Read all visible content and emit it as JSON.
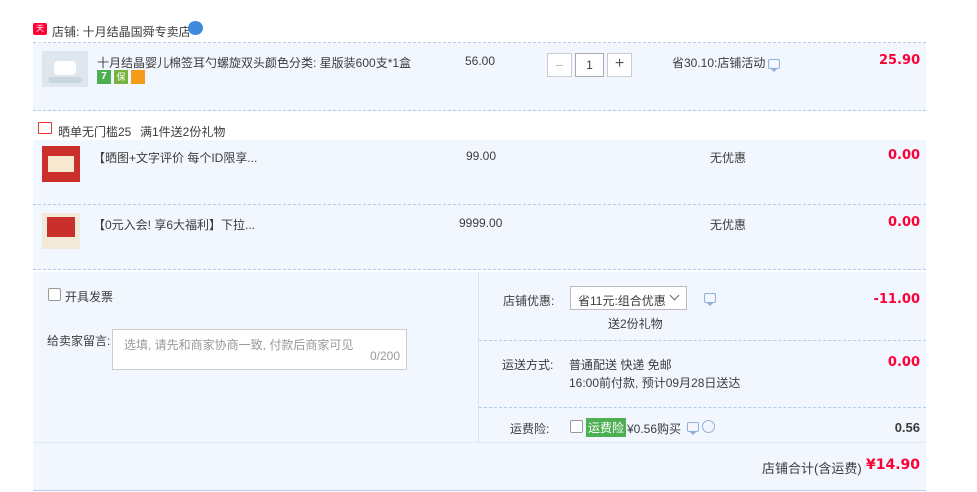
{
  "shop": {
    "badge": "天猫",
    "name": "店铺: 十月结晶国舜专卖店"
  },
  "item": {
    "title": "十月结晶婴儿棉签耳勺螺旋双头...",
    "sku": "颜色分类: 星版装600支*1盒",
    "price": "56.00",
    "minus": "−",
    "qty": "1",
    "plus": "+",
    "discount": "省30.10:店铺活动",
    "subtotal": "25.90",
    "badges": [
      "7",
      "保",
      "卡"
    ]
  },
  "gift_header": {
    "line1": "晒单无门槛25",
    "line2": "满1件送2份礼物"
  },
  "gifts": [
    {
      "title": "【晒图+文字评价 每个ID限享...",
      "price": "99.00",
      "promo": "无优惠",
      "subtotal": "0.00"
    },
    {
      "title": "【0元入会! 享6大福利】下拉...",
      "price": "9999.00",
      "promo": "无优惠",
      "subtotal": "0.00"
    }
  ],
  "invoice": {
    "label": "开具发票"
  },
  "message": {
    "label": "给卖家留言:",
    "placeholder": "选填, 请先和商家协商一致, 付款后商家可见",
    "counter": "0/200"
  },
  "shop_discount": {
    "label": "店铺优惠:",
    "selected": "省11元:组合优惠",
    "note": "送2份礼物",
    "amount": "-11.00"
  },
  "shipping": {
    "label": "运送方式:",
    "method": "普通配送 快递 免邮",
    "eta": "16:00前付款, 预计09月28日送达",
    "amount": "0.00"
  },
  "insurance": {
    "label": "运费险:",
    "tag": "运费险",
    "price": "¥0.56购买",
    "amount": "0.56"
  },
  "total": {
    "label": "店铺合计(含运费)",
    "amount": "¥14.90"
  },
  "colors": {
    "accent_red": "#ff0036",
    "bg_blue": "#f2f7ff",
    "border_blue": "#b4cbe6"
  }
}
